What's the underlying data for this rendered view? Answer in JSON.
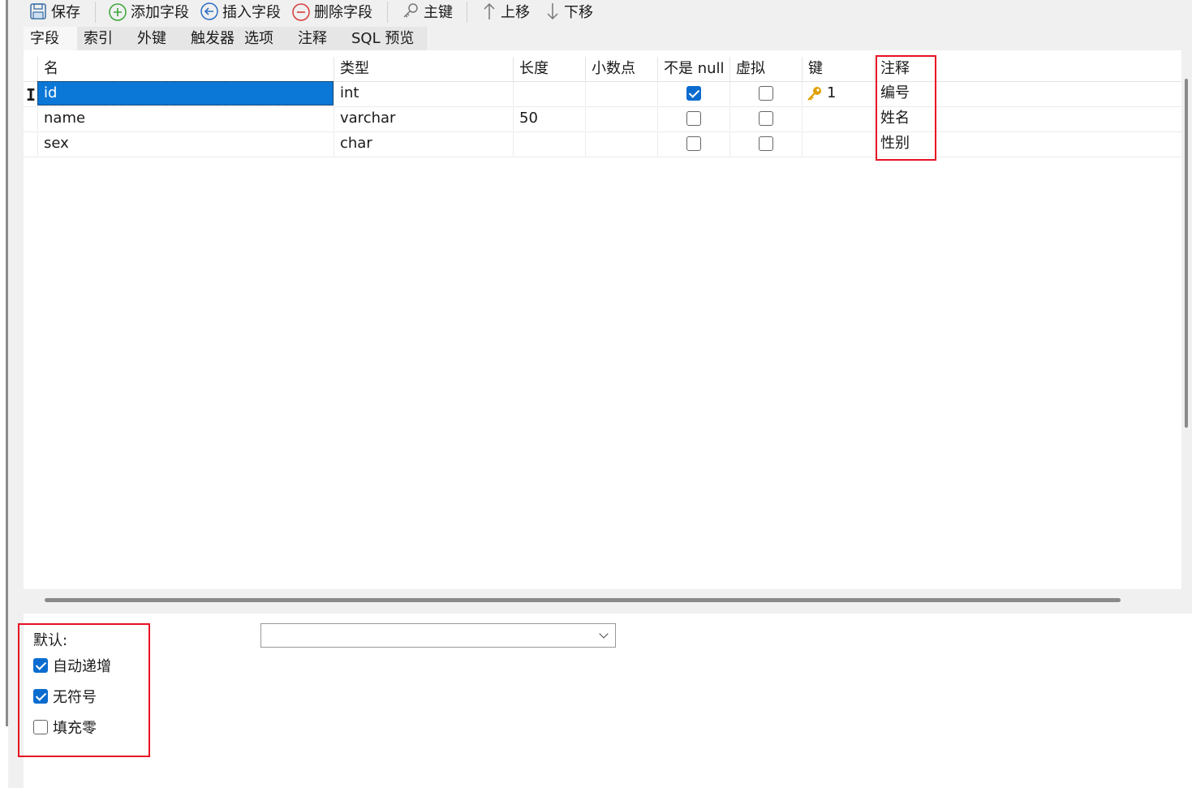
{
  "toolbar": {
    "save": "保存",
    "add_field": "添加字段",
    "insert_field": "插入字段",
    "delete_field": "删除字段",
    "primary_key": "主键",
    "move_up": "上移",
    "move_down": "下移"
  },
  "tabs": [
    "字段",
    "索引",
    "外键",
    "触发器",
    "选项",
    "注释",
    "SQL 预览"
  ],
  "grid": {
    "columns": [
      "名",
      "类型",
      "长度",
      "小数点",
      "不是 null",
      "虚拟",
      "键",
      "注释"
    ],
    "rows": [
      {
        "name": "id",
        "type": "int",
        "length": "",
        "decimals": "",
        "not_null": true,
        "virtual": false,
        "key": "1",
        "comment": "编号"
      },
      {
        "name": "name",
        "type": "varchar",
        "length": "50",
        "decimals": "",
        "not_null": false,
        "virtual": false,
        "key": "",
        "comment": "姓名"
      },
      {
        "name": "sex",
        "type": "char",
        "length": "",
        "decimals": "",
        "not_null": false,
        "virtual": false,
        "key": "",
        "comment": "性别"
      }
    ]
  },
  "properties": {
    "default_label": "默认:",
    "default_value": "",
    "auto_increment": {
      "label": "自动递增",
      "checked": true
    },
    "unsigned": {
      "label": "无符号",
      "checked": true
    },
    "zerofill": {
      "label": "填充零",
      "checked": false
    }
  },
  "colors": {
    "selection": "#0b78d7",
    "checkbox_on": "#0b6ccf",
    "highlight_box": "#e81123",
    "key_icon": "#e0a000"
  }
}
